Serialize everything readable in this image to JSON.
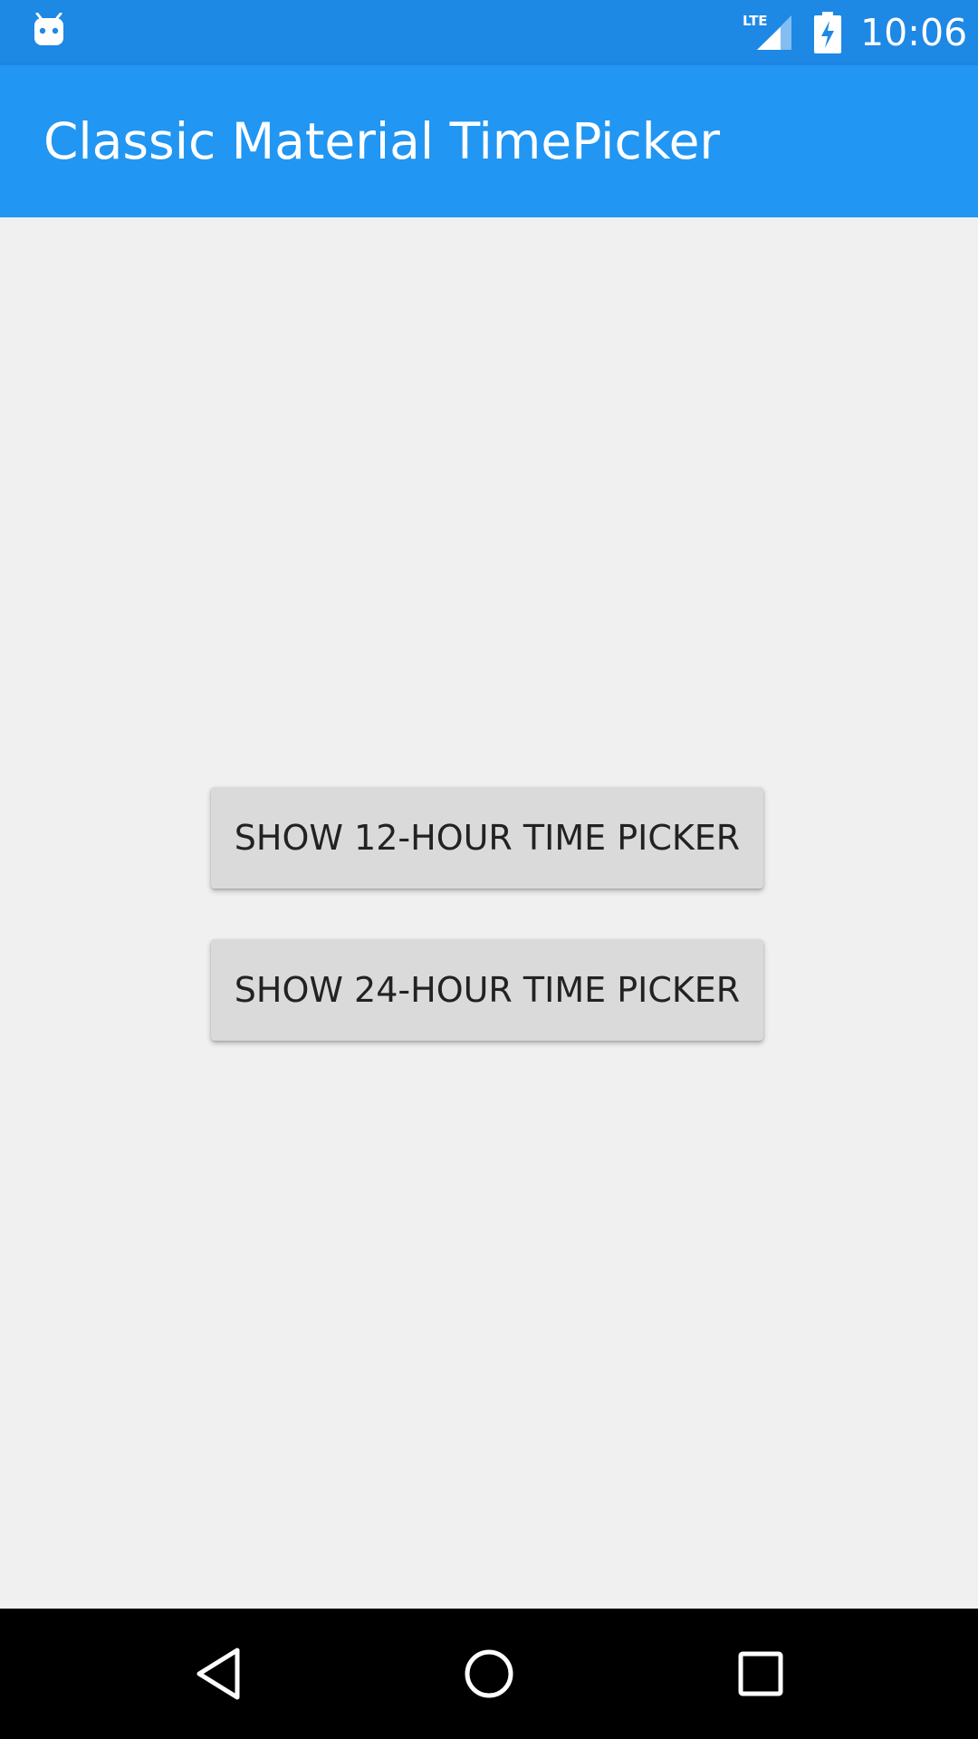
{
  "status_bar": {
    "time": "10:06",
    "network_type": "LTE",
    "icons": [
      "android-icon",
      "lte-signal-icon",
      "battery-charging-icon"
    ],
    "background_color": "#1e88e5"
  },
  "app_bar": {
    "title": "Classic Material TimePicker",
    "background_color": "#2196f3"
  },
  "main": {
    "buttons": [
      {
        "label": "SHOW 12-HOUR TIME PICKER"
      },
      {
        "label": "SHOW 24-HOUR TIME PICKER"
      }
    ]
  },
  "nav_bar": {
    "icons": [
      "back-icon",
      "home-icon",
      "recents-icon"
    ]
  }
}
